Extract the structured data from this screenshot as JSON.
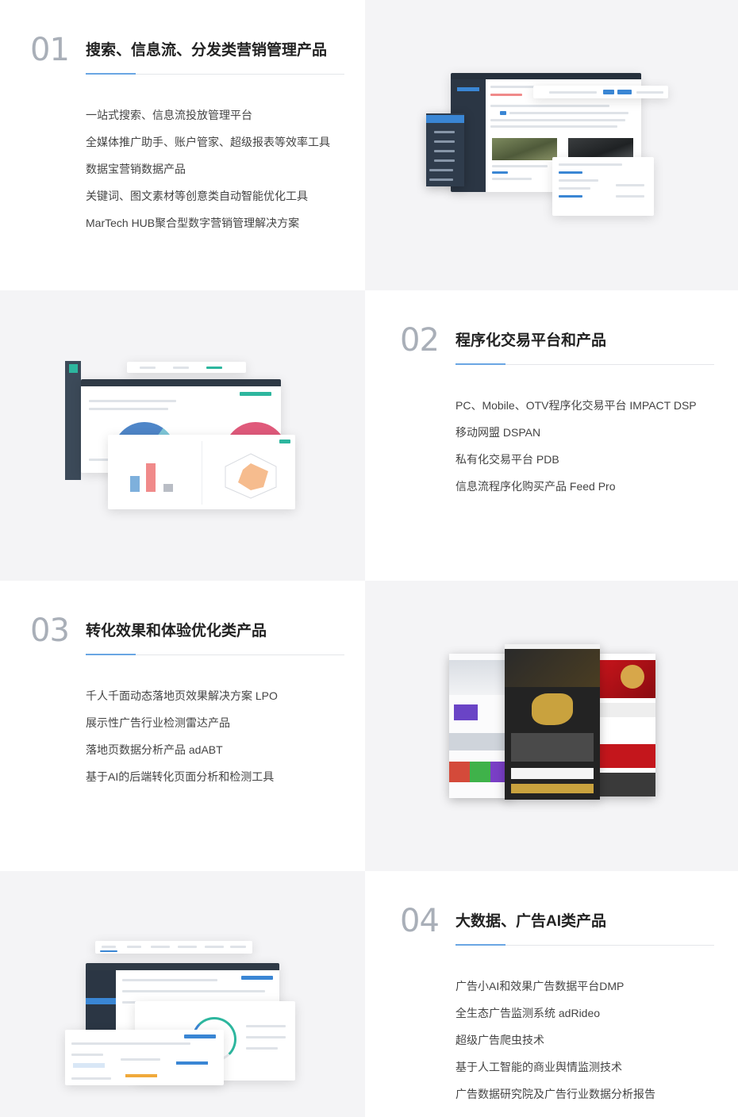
{
  "sections": [
    {
      "number": "01",
      "title": "搜索、信息流、分发类营销管理产品",
      "items": [
        "一站式搜索、信息流投放管理平台",
        "全媒体推广助手、账户管家、超级报表等效率工具",
        "数据宝营销数据产品",
        "关键词、图文素材等创意类自动智能优化工具",
        "MarTech HUB聚合型数字营销管理解决方案"
      ]
    },
    {
      "number": "02",
      "title": "程序化交易平台和产品",
      "items": [
        "PC、Mobile、OTV程序化交易平台 IMPACT DSP",
        "移动网盟 DSPAN",
        "私有化交易平台 PDB",
        "信息流程序化购买产品 Feed Pro"
      ]
    },
    {
      "number": "03",
      "title": "转化效果和体验优化类产品",
      "items": [
        "千人千面动态落地页效果解决方案 LPO",
        "展示性广告行业检测雷达产品",
        "落地页数据分析产品 adABT",
        "基于AI的后端转化页面分析和检测工具"
      ]
    },
    {
      "number": "04",
      "title": "大数据、广告AI类产品",
      "items": [
        "广告小AI和效果广告数据平台DMP",
        "全生态广告监测系统 adRideo",
        "超级广告爬虫技术",
        "基于人工智能的商业舆情监测技术",
        "广告数据研究院及广告行业数据分析报告"
      ]
    }
  ],
  "colors": {
    "grey_panel": "#f4f4f6",
    "accent_line": "#6aa6e3",
    "number_grey": "#a9afb8"
  }
}
